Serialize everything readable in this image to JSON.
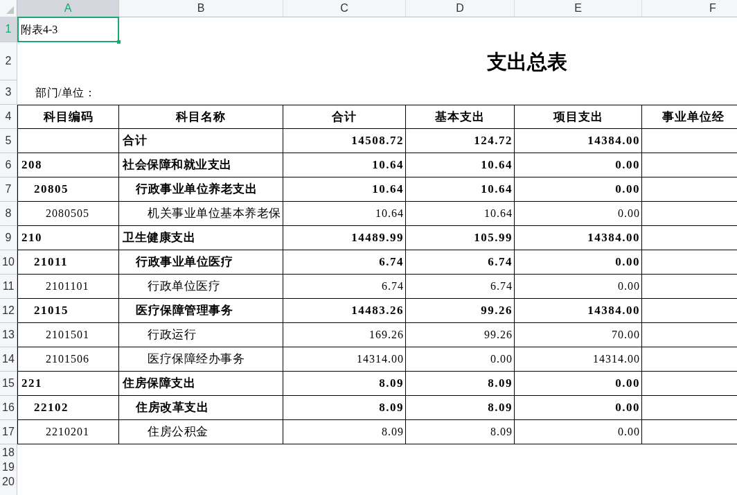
{
  "sheet": {
    "column_headers": [
      {
        "label": "A",
        "selected": true
      },
      {
        "label": "B",
        "selected": false
      },
      {
        "label": "C",
        "selected": false
      },
      {
        "label": "D",
        "selected": false
      },
      {
        "label": "E",
        "selected": false
      },
      {
        "label": "F",
        "selected": false
      }
    ],
    "row_headers": [
      {
        "label": "1",
        "selected": true
      },
      {
        "label": "2",
        "selected": false
      },
      {
        "label": "3",
        "selected": false
      },
      {
        "label": "4",
        "selected": false
      },
      {
        "label": "5",
        "selected": false
      },
      {
        "label": "6",
        "selected": false
      },
      {
        "label": "7",
        "selected": false
      },
      {
        "label": "8",
        "selected": false
      },
      {
        "label": "9",
        "selected": false
      },
      {
        "label": "10",
        "selected": false
      },
      {
        "label": "11",
        "selected": false
      },
      {
        "label": "12",
        "selected": false
      },
      {
        "label": "13",
        "selected": false
      },
      {
        "label": "14",
        "selected": false
      },
      {
        "label": "15",
        "selected": false
      },
      {
        "label": "16",
        "selected": false
      },
      {
        "label": "17",
        "selected": false
      },
      {
        "label": "18",
        "selected": false
      },
      {
        "label": "19",
        "selected": false
      },
      {
        "label": "20",
        "selected": false
      }
    ]
  },
  "note": {
    "text": "附表4-3",
    "selected": true
  },
  "title": "支出总表",
  "unit_label": "部门/单位：",
  "table": {
    "columns": [
      "科目编码",
      "科目名称",
      "合计",
      "基本支出",
      "项目支出",
      "事业单位经"
    ],
    "rows": [
      {
        "kind": "total",
        "name": "合计",
        "values": [
          "14508.72",
          "124.72",
          "14384.00"
        ]
      },
      {
        "kind": "item",
        "code": "208",
        "name": "社会保障和就业支出",
        "values": [
          "10.64",
          "10.64",
          "0.00"
        ],
        "children": [
          {
            "kind": "item",
            "code": "20805",
            "name": "行政事业单位养老支出",
            "values": [
              "10.64",
              "10.64",
              "0.00"
            ],
            "children": [
              {
                "kind": "item",
                "code": "2080505",
                "name": "机关事业单位基本养老保",
                "values": [
                  "10.64",
                  "10.64",
                  "0.00"
                ]
              }
            ]
          }
        ]
      },
      {
        "kind": "item",
        "code": "210",
        "name": "卫生健康支出",
        "values": [
          "14489.99",
          "105.99",
          "14384.00"
        ],
        "children": [
          {
            "kind": "item",
            "code": "21011",
            "name": "行政事业单位医疗",
            "values": [
              "6.74",
              "6.74",
              "0.00"
            ],
            "children": [
              {
                "kind": "item",
                "code": "2101101",
                "name": "行政单位医疗",
                "values": [
                  "6.74",
                  "6.74",
                  "0.00"
                ]
              }
            ]
          },
          {
            "kind": "item",
            "code": "21015",
            "name": "医疗保障管理事务",
            "values": [
              "14483.26",
              "99.26",
              "14384.00"
            ],
            "children": [
              {
                "kind": "item",
                "code": "2101501",
                "name": "行政运行",
                "values": [
                  "169.26",
                  "99.26",
                  "70.00"
                ]
              },
              {
                "kind": "item",
                "code": "2101506",
                "name": "医疗保障经办事务",
                "values": [
                  "14314.00",
                  "0.00",
                  "14314.00"
                ]
              }
            ]
          }
        ]
      },
      {
        "kind": "item",
        "code": "221",
        "name": "住房保障支出",
        "values": [
          "8.09",
          "8.09",
          "0.00"
        ],
        "children": [
          {
            "kind": "item",
            "code": "22102",
            "name": "住房改革支出",
            "values": [
              "8.09",
              "8.09",
              "0.00"
            ],
            "children": [
              {
                "kind": "item",
                "code": "2210201",
                "name": "住房公积金",
                "values": [
                  "8.09",
                  "8.09",
                  "0.00"
                ]
              }
            ]
          }
        ]
      }
    ]
  }
}
